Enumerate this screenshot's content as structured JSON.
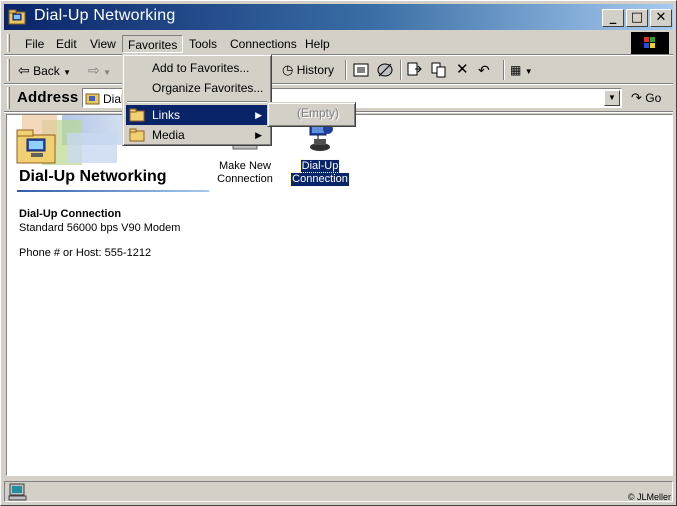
{
  "window": {
    "title": "Dial-Up Networking",
    "minimize": "_",
    "maximize": "□",
    "close": "✕"
  },
  "menubar": {
    "items": [
      {
        "label": "File"
      },
      {
        "label": "Edit"
      },
      {
        "label": "View"
      },
      {
        "label": "Favorites"
      },
      {
        "label": "Tools"
      },
      {
        "label": "Connections"
      },
      {
        "label": "Help"
      }
    ]
  },
  "toolbar": {
    "back_label": "Back",
    "history_label": "History"
  },
  "address": {
    "label": "Address",
    "value": "Dial"
  },
  "go_label": "Go",
  "favorites_menu": {
    "add": "Add to Favorites...",
    "organize": "Organize Favorites...",
    "links": "Links",
    "media": "Media"
  },
  "links_submenu": {
    "empty": "(Empty)"
  },
  "pane": {
    "title": "Dial-Up Networking",
    "selected_title": "Dial-Up Connection",
    "modem": "Standard 56000 bps V90 Modem",
    "phone": "Phone # or Host: 555-1212"
  },
  "icons": [
    {
      "label_line1": "Make New",
      "label_line2": "Connection"
    },
    {
      "label_line1": "Dial-Up",
      "label_line2": "Connection"
    }
  ],
  "credit": "© JLMeller",
  "colors": {
    "title_gradient_start": "#0a246a",
    "title_gradient_end": "#a6caf0",
    "highlight": "#0a246a",
    "face": "#d4d0c8"
  }
}
